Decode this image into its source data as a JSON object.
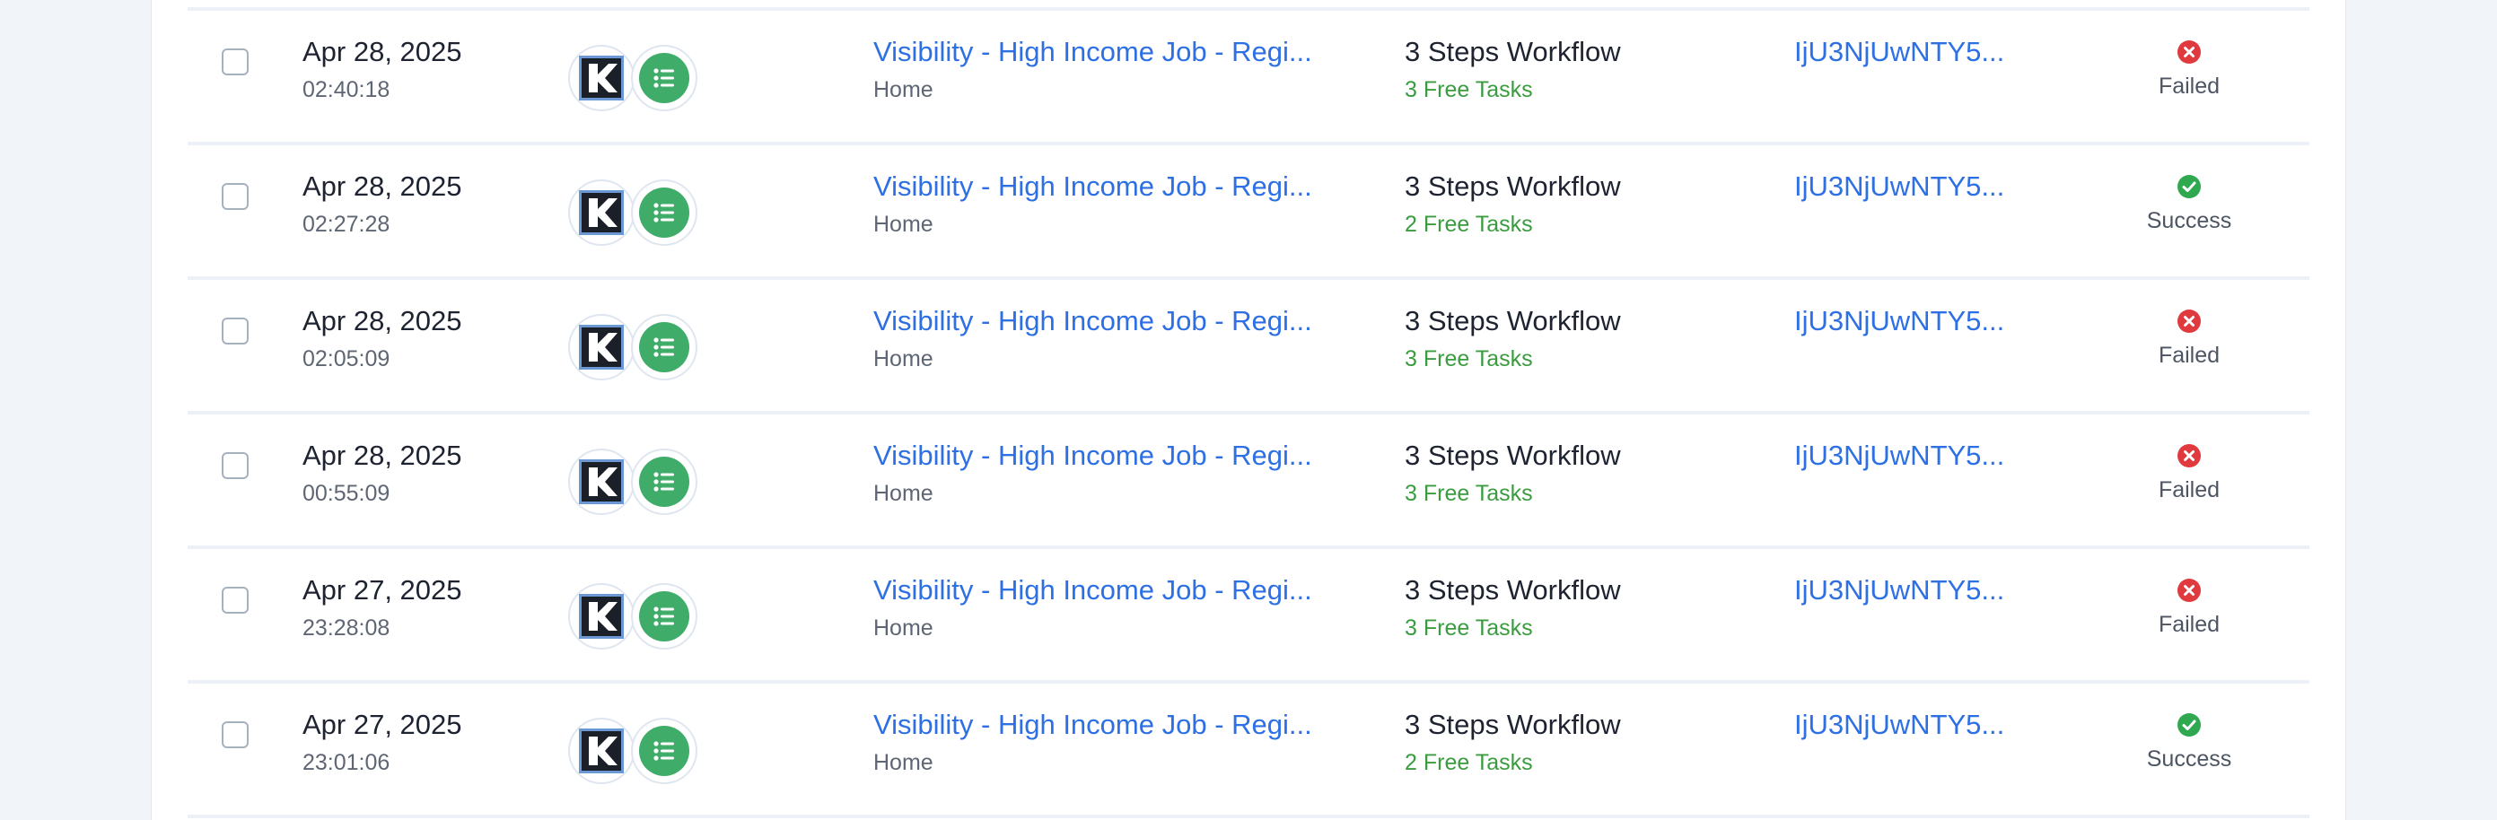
{
  "colors": {
    "link": "#2d6fe4",
    "free_tasks": "#3a9c3f",
    "failed": "#e0393e",
    "success": "#2fa84f",
    "app_green": "#3fac6a",
    "app_dark": "#1b1f27"
  },
  "icons": {
    "app_1": "k-logo-icon",
    "app_2": "list-icon",
    "failed": "error-x-icon",
    "success": "check-icon"
  },
  "rows": [
    {
      "date": "Apr 28, 2025",
      "time": "02:40:18",
      "zap_name": "Visibility - High Income Job - Regi...",
      "folder": "Home",
      "steps": "3 Steps Workflow",
      "tasks": "3 Free Tasks",
      "run_id": "IjU3NjUwNTY5...",
      "status": "Failed"
    },
    {
      "date": "Apr 28, 2025",
      "time": "02:27:28",
      "zap_name": "Visibility - High Income Job - Regi...",
      "folder": "Home",
      "steps": "3 Steps Workflow",
      "tasks": "2 Free Tasks",
      "run_id": "IjU3NjUwNTY5...",
      "status": "Success"
    },
    {
      "date": "Apr 28, 2025",
      "time": "02:05:09",
      "zap_name": "Visibility - High Income Job - Regi...",
      "folder": "Home",
      "steps": "3 Steps Workflow",
      "tasks": "3 Free Tasks",
      "run_id": "IjU3NjUwNTY5...",
      "status": "Failed"
    },
    {
      "date": "Apr 28, 2025",
      "time": "00:55:09",
      "zap_name": "Visibility - High Income Job - Regi...",
      "folder": "Home",
      "steps": "3 Steps Workflow",
      "tasks": "3 Free Tasks",
      "run_id": "IjU3NjUwNTY5...",
      "status": "Failed"
    },
    {
      "date": "Apr 27, 2025",
      "time": "23:28:08",
      "zap_name": "Visibility - High Income Job - Regi...",
      "folder": "Home",
      "steps": "3 Steps Workflow",
      "tasks": "3 Free Tasks",
      "run_id": "IjU3NjUwNTY5...",
      "status": "Failed"
    },
    {
      "date": "Apr 27, 2025",
      "time": "23:01:06",
      "zap_name": "Visibility - High Income Job - Regi...",
      "folder": "Home",
      "steps": "3 Steps Workflow",
      "tasks": "2 Free Tasks",
      "run_id": "IjU3NjUwNTY5...",
      "status": "Success"
    }
  ]
}
